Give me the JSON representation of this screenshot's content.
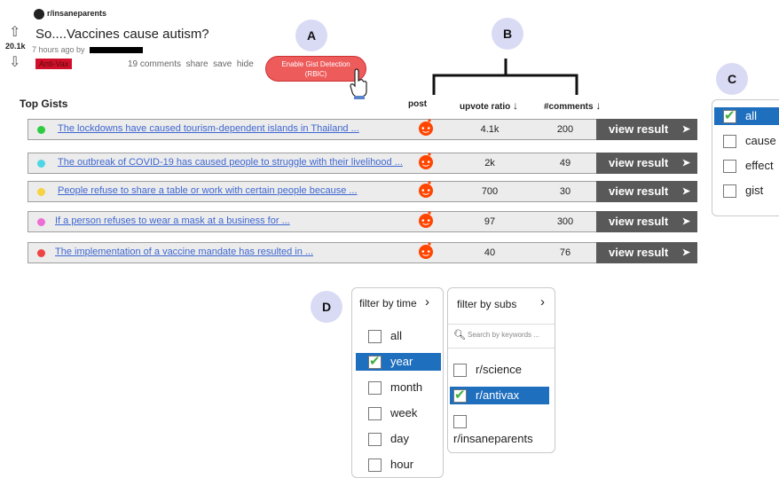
{
  "post": {
    "subreddit": "r/insaneparents",
    "score": "20.1k",
    "title": "So....Vaccines cause autism?",
    "meta": "7 hours ago by",
    "flair": "Anti-Vax",
    "actions": [
      "19 comments",
      "share",
      "save",
      "hide"
    ]
  },
  "gist_button": {
    "line1": "Enable Gist Detection",
    "line2": "(RBIC)"
  },
  "callouts": {
    "a": "A",
    "b": "B",
    "c": "C",
    "d": "D"
  },
  "table": {
    "heading": "Top Gists",
    "col_post": "post",
    "col_upvote": "upvote ratio",
    "col_comments": "#comments",
    "view_label": "view result",
    "rows": [
      {
        "color": "#2ecc40",
        "title": "The lockdowns have caused tourism-dependent islands in Thailand ...",
        "upvote": "4.1k",
        "comments": "200"
      },
      {
        "color": "#4dd6e6",
        "title": "The outbreak of COVID-19 has caused people to struggle with their livelihood ...",
        "upvote": "2k",
        "comments": "49"
      },
      {
        "color": "#f5d342",
        "title": "People refuse to share a table or work with certain people because ...",
        "upvote": "700",
        "comments": "30"
      },
      {
        "color": "#ee6fd3",
        "title": "If a person refuses to wear a mask at a business for ...",
        "upvote": "97",
        "comments": "300"
      },
      {
        "color": "#ee4444",
        "title": "The implementation of a vaccine mandate has resulted in ...",
        "upvote": "40",
        "comments": "76"
      }
    ]
  },
  "type_filter": {
    "options": [
      {
        "label": "all",
        "checked": true
      },
      {
        "label": "cause",
        "checked": false
      },
      {
        "label": "effect",
        "checked": false
      },
      {
        "label": "gist",
        "checked": false
      }
    ]
  },
  "time_filter": {
    "header": "filter by time",
    "options": [
      {
        "label": "all",
        "checked": false
      },
      {
        "label": "year",
        "checked": true
      },
      {
        "label": "month",
        "checked": false
      },
      {
        "label": "week",
        "checked": false
      },
      {
        "label": "day",
        "checked": false
      },
      {
        "label": "hour",
        "checked": false
      }
    ]
  },
  "subs_filter": {
    "header": "filter by subs",
    "search_placeholder": "Search by keywords ...",
    "options": [
      {
        "label": "r/science",
        "checked": false
      },
      {
        "label": "r/antivax",
        "checked": true
      },
      {
        "label": "r/insaneparents",
        "checked": false
      }
    ]
  },
  "colors": {
    "accent_blue": "#1f6fbf",
    "gist_button": "#ee5b5b",
    "view_button": "#595959",
    "callout": "#d9dbf5",
    "reddit_orange": "#ff4500"
  }
}
